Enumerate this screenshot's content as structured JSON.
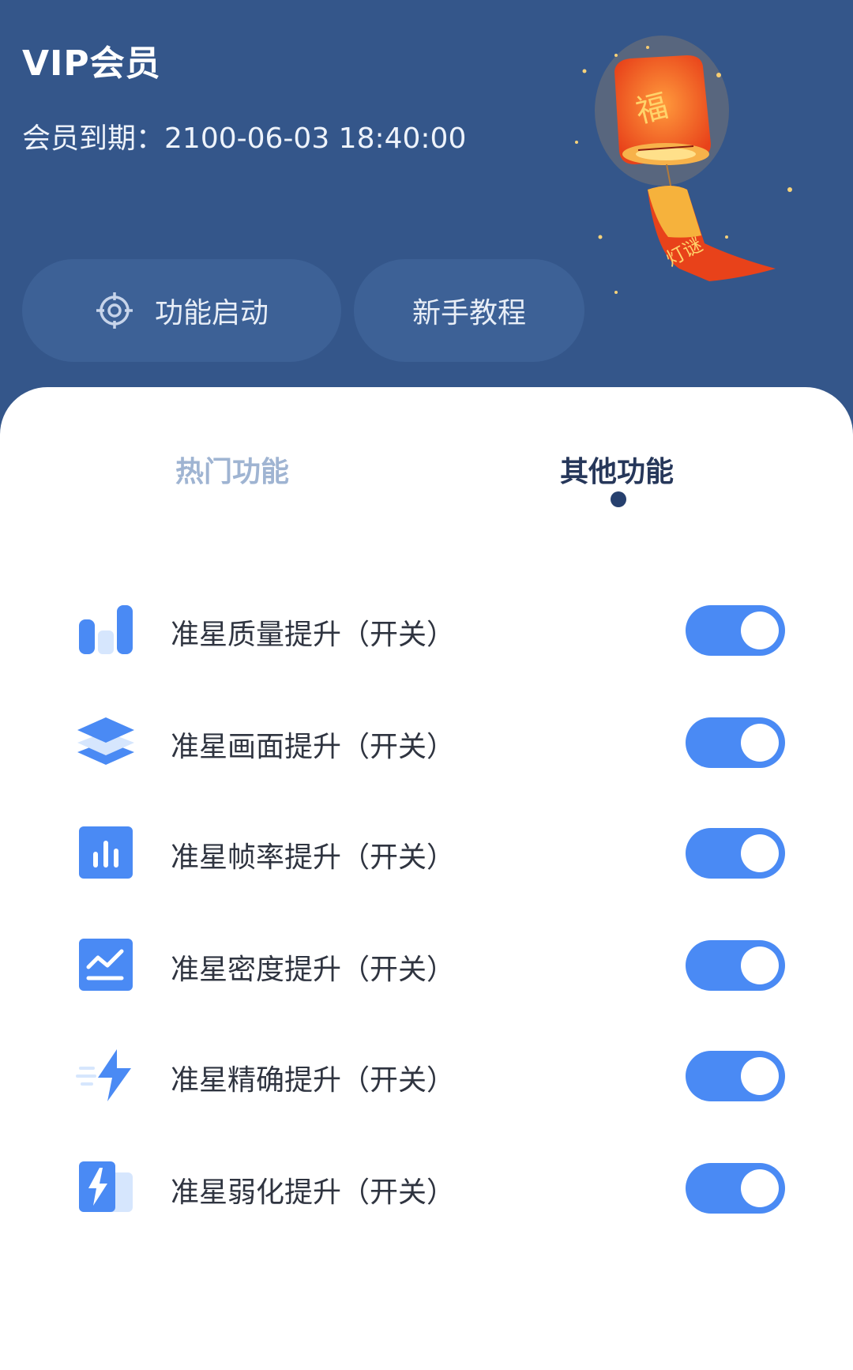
{
  "header": {
    "title": "VIP会员",
    "expiry_label": "会员到期：",
    "expiry_value": "2100-06-03 18:40:00",
    "buttons": [
      {
        "label": "功能启动",
        "icon": "crosshair-icon"
      },
      {
        "label": "新手教程"
      }
    ],
    "lantern_text": [
      "福",
      "灯谜"
    ]
  },
  "tabs": [
    {
      "label": "热门功能",
      "active": false
    },
    {
      "label": "其他功能",
      "active": true
    }
  ],
  "features": [
    {
      "label": "准星质量提升（开关）",
      "icon": "bar-chart-icon",
      "on": true
    },
    {
      "label": "准星画面提升（开关）",
      "icon": "layers-icon",
      "on": true
    },
    {
      "label": "准星帧率提升（开关）",
      "icon": "stats-icon",
      "on": true
    },
    {
      "label": "准星密度提升（开关）",
      "icon": "trend-icon",
      "on": true
    },
    {
      "label": "准星精确提升（开关）",
      "icon": "lightning-icon",
      "on": true
    },
    {
      "label": "准星弱化提升（开关）",
      "icon": "battery-charge-icon",
      "on": true
    }
  ],
  "colors": {
    "header_bg": "#34568a",
    "pill_bg": "#3d6196",
    "accent": "#4a8af4",
    "tab_active": "#26375a",
    "tab_inactive": "#9fb4d2"
  }
}
